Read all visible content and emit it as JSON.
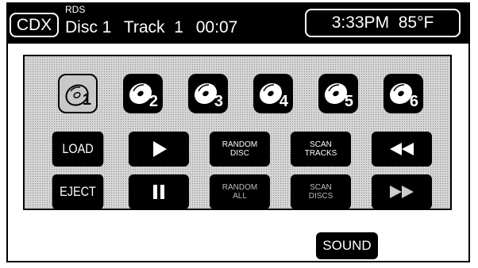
{
  "header": {
    "source": "CDX",
    "rds": "RDS",
    "disc": "Disc 1",
    "track": "Track  1",
    "time": "00:07",
    "clock": "3:33PM  85°F"
  },
  "discs": [
    "1",
    "2",
    "3",
    "4",
    "5",
    "6"
  ],
  "selected_disc": "1",
  "controls": {
    "load": "LOAD",
    "eject": "EJECT",
    "random_disc_1": "RANDOM",
    "random_disc_2": "DISC",
    "random_all_1": "RANDOM",
    "random_all_2": "ALL",
    "scan_tracks_1": "SCAN",
    "scan_tracks_2": "TRACKS",
    "scan_discs_1": "SCAN",
    "scan_discs_2": "DISCS"
  },
  "sound_label": "SOUND",
  "colors": {
    "background": "#ffffff",
    "button": "#000000",
    "panel": "#d6d6d6"
  },
  "icons": [
    "disc-icon",
    "play-icon",
    "pause-icon",
    "rewind-icon",
    "fast-forward-icon"
  ]
}
